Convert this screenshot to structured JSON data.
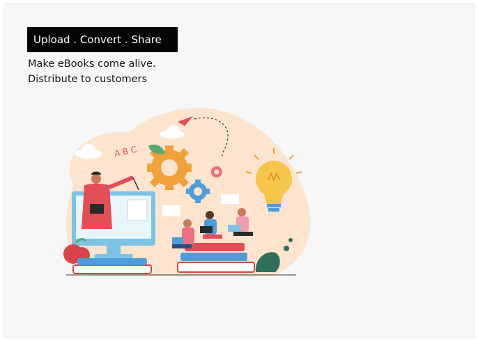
{
  "hero": {
    "tagline": "Upload . Convert . Share",
    "subtitle_line1": "Make eBooks come alive.",
    "subtitle_line2": "Distribute to customers",
    "illustration_letters": "A B C"
  },
  "colors": {
    "tagline_bg": "#050505",
    "blob": "#fde4cf",
    "gear_orange": "#f0a23a",
    "gear_blue": "#4f9dd8",
    "gear_pink": "#ee6f7e",
    "book_red": "#d9434a",
    "screen_blue": "#7cc3e6"
  }
}
